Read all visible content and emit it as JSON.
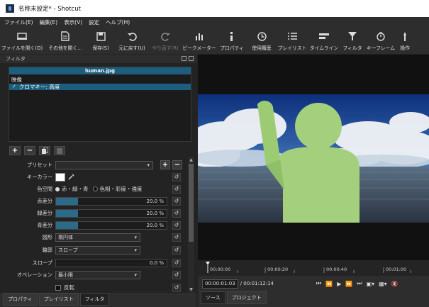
{
  "window": {
    "title": "名称未設定* - Shotcut"
  },
  "menu": [
    "ファイル(E)",
    "編集(E)",
    "表示(V)",
    "設定",
    "ヘルプ(H)"
  ],
  "toolbar": [
    {
      "label": "ファイルを開く(O)",
      "icon": "open-file-icon",
      "enabled": true
    },
    {
      "label": "その他を開く...",
      "icon": "open-other-icon",
      "enabled": true
    },
    {
      "label": "保存(S)",
      "icon": "save-icon",
      "enabled": true
    },
    {
      "label": "元に戻す(U)",
      "icon": "undo-icon",
      "enabled": true
    },
    {
      "label": "やり直す(R)",
      "icon": "redo-icon",
      "enabled": false
    },
    {
      "label": "ピークメーター",
      "icon": "peak-meter-icon",
      "enabled": true
    },
    {
      "label": "プロパティ",
      "icon": "properties-icon",
      "enabled": true
    },
    {
      "label": "使用履歴",
      "icon": "history-icon",
      "enabled": true
    },
    {
      "label": "プレイリスト",
      "icon": "playlist-icon",
      "enabled": true
    },
    {
      "label": "タイムライン",
      "icon": "timeline-icon",
      "enabled": true
    },
    {
      "label": "フィルタ",
      "icon": "filter-icon",
      "enabled": true
    },
    {
      "label": "キーフレーム",
      "icon": "keyframe-icon",
      "enabled": true
    },
    {
      "label": "操作",
      "icon": "actions-icon",
      "enabled": true
    }
  ],
  "filters_panel": {
    "title": "フィルタ",
    "clip_name": "human.jpg",
    "section_label": "映像",
    "filter_items": [
      {
        "label": "クロマキー: 高度",
        "checked": true
      }
    ],
    "preset_label": "プリセット",
    "preset_value": "",
    "key_color_label": "キーカラー",
    "key_color": "#ffffff",
    "color_space_label": "色空間",
    "color_space_options": [
      {
        "label": "赤・緑・青",
        "selected": true
      },
      {
        "label": "色相・彩度・強度",
        "selected": false
      }
    ],
    "sliders": [
      {
        "label": "赤差分",
        "value": "20.0 %",
        "fraction": 0.2
      },
      {
        "label": "緑差分",
        "value": "20.0 %",
        "fraction": 0.2
      },
      {
        "label": "青差分",
        "value": "20.0 %",
        "fraction": 0.2
      }
    ],
    "shape_label": "図形",
    "shape_value": "楕円体",
    "edge_label": "輪郭",
    "edge_value": "スロープ",
    "slope_label": "スロープ",
    "slope_value": "0.0 %",
    "slope_fraction": 0.0,
    "operation_label": "オペレーション",
    "operation_value": "最小限",
    "invert_label": "反転",
    "invert_checked": false
  },
  "left_tabs": [
    {
      "label": "プロパティ",
      "active": false
    },
    {
      "label": "プレイリスト",
      "active": false
    },
    {
      "label": "フィルタ",
      "active": true
    }
  ],
  "timeline_ruler": [
    "00:00:00",
    "00:00:20",
    "00:00:40",
    "00:01:00"
  ],
  "timecode": {
    "current": "00:00:01:03",
    "total": "/ 00:01:12:14"
  },
  "right_tabs": [
    {
      "label": "ソース",
      "active": true
    },
    {
      "label": "プロジェクト",
      "active": false
    }
  ],
  "colors": {
    "accent": "#1d5e7e",
    "figure": "#a4d07e",
    "figure_shade": "#8fbf69"
  }
}
